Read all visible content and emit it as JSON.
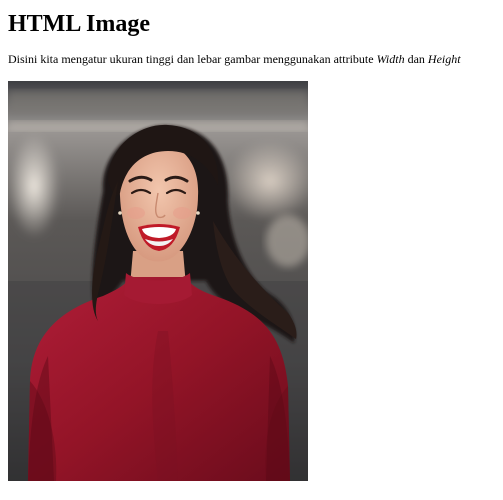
{
  "page": {
    "heading": "HTML Image",
    "paragraph": {
      "text_before": "Disini kita mengatur ukuran tinggi dan lebar gambar menggunakan attribute ",
      "width_word": "Width",
      "middle": " dan ",
      "height_word": "Height"
    },
    "image": {
      "alt": "Smiling woman with dark wavy hair wearing a red top",
      "colors": {
        "top": "#FFFFFF",
        "shirt": "#9E1530",
        "hair": "#1F1614",
        "skin": "#E8B39A",
        "lips": "#C01A28",
        "background_dark": "#4A4949",
        "background_light": "#BDB8B0"
      }
    }
  }
}
